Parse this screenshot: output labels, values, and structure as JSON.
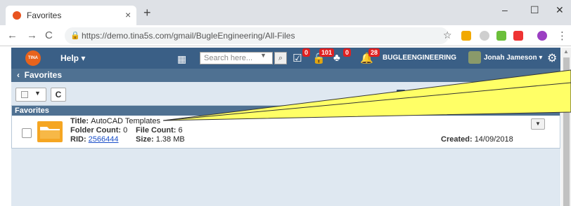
{
  "browser": {
    "tab_title": "Favorites",
    "url": "https://demo.tina5s.com/gmail/BugleEngineering/All-Files"
  },
  "header": {
    "logo_text": "TINA",
    "help_label": "Help ▾",
    "search_placeholder": "Search here...",
    "badges": {
      "tasks": "0",
      "locks": "101",
      "org": "0",
      "alerts": "28"
    },
    "company": "BUGLEENGINEERING",
    "user_name": "Jonah Jameson ▾"
  },
  "breadcrumb": {
    "label": "Favorites"
  },
  "panel": {
    "title": "Favorites",
    "item": {
      "title_label": "Title:",
      "title_value": "AutoCAD Templates",
      "folder_count_label": "Folder Count:",
      "folder_count": "0",
      "file_count_label": "File Count:",
      "file_count": "6",
      "rid_label": "RID:",
      "rid": "2566444",
      "size_label": "Size:",
      "size": "1.38 MB",
      "created_label": "Created:",
      "created": "14/09/2018"
    }
  },
  "colors": {
    "header_bg": "#3a5f86",
    "bar_bg": "#4f7192",
    "content_bg": "#dfe8f1",
    "badge": "#e02020",
    "folder": "#f5a623",
    "callout": "#ffff66"
  }
}
